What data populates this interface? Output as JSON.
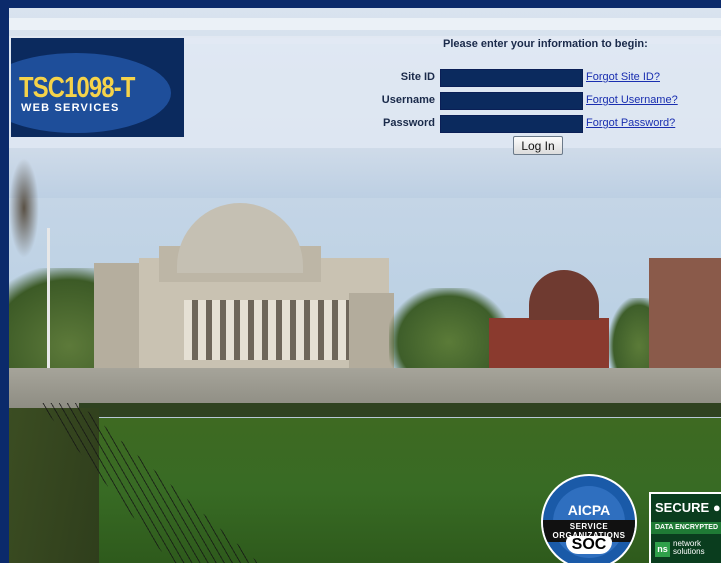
{
  "logo": {
    "brand": "TSC1098-T",
    "sub": "WEB SERVICES"
  },
  "login": {
    "prompt": "Please enter your information to begin:",
    "fields": [
      {
        "label": "Site ID",
        "value": "",
        "link": "Forgot Site ID?"
      },
      {
        "label": "Username",
        "value": "",
        "link": "Forgot Username?"
      },
      {
        "label": "Password",
        "value": "",
        "link": "Forgot Password?"
      }
    ],
    "button": "Log In"
  },
  "badges": {
    "aicpa": {
      "title": "AICPA",
      "band": "SERVICE ORGANIZATIONS",
      "soc": "SOC"
    },
    "secure": {
      "title": "SECURE",
      "band": "DATA ENCRYPTED",
      "logo": "ns",
      "vendor1": "network",
      "vendor2": "solutions"
    }
  }
}
